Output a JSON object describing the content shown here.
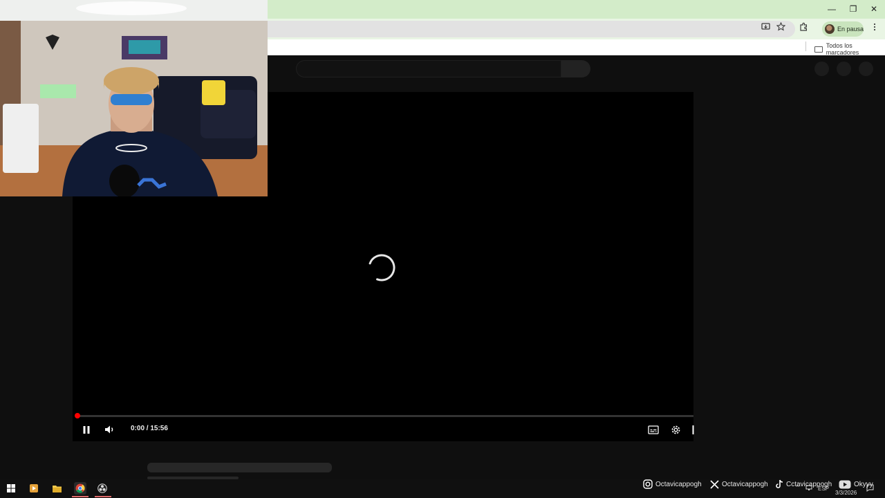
{
  "browser": {
    "window_controls": {
      "minimize": "—",
      "restore": "❐",
      "close": "✕"
    },
    "profile_label": "En pausa",
    "bookmarks_folder": "Todos los marcadores"
  },
  "player": {
    "time_display": "0:00 / 15:56",
    "progress_fraction": 0.003
  },
  "socials": [
    {
      "platform": "instagram-icon",
      "handle": "Octavicappogh"
    },
    {
      "platform": "x-icon",
      "handle": "Octavicappogh"
    },
    {
      "platform": "tiktok-icon",
      "handle": "Cctavicappogh"
    },
    {
      "platform": "youtube-icon",
      "handle": "Okyyy"
    }
  ],
  "taskbar": {
    "language": "ESP",
    "date": "3/3/2026"
  },
  "colors": {
    "titlebar": "#d3ecc9",
    "yt_background": "#0f0f0f",
    "progress_red": "#ff0000"
  }
}
